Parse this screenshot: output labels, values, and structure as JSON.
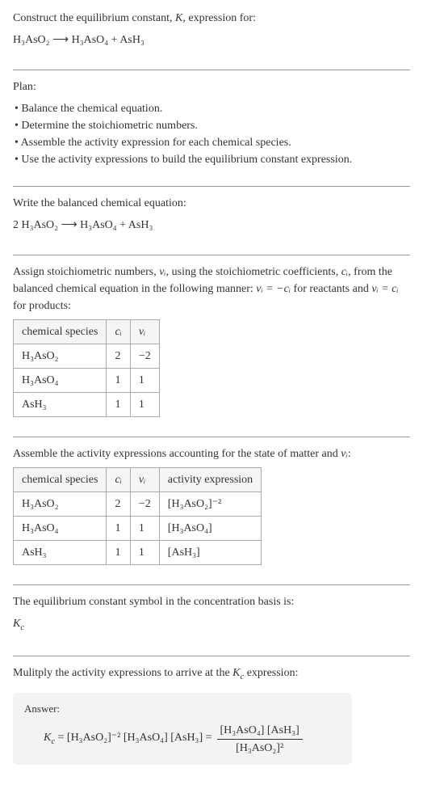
{
  "section1": {
    "line1_a": "Construct the equilibrium constant, ",
    "line1_b": ", expression for:",
    "equation": "H₃AsO₂  ⟶  H₃AsO₄ + AsH₃"
  },
  "section2": {
    "heading": "Plan:",
    "b1": "• Balance the chemical equation.",
    "b2": "• Determine the stoichiometric numbers.",
    "b3": "• Assemble the activity expression for each chemical species.",
    "b4": "• Use the activity expressions to build the equilibrium constant expression."
  },
  "section3": {
    "heading": "Write the balanced chemical equation:",
    "equation": "2 H₃AsO₂  ⟶  H₃AsO₄ + AsH₃"
  },
  "section4": {
    "intro_a": "Assign stoichiometric numbers, ",
    "intro_b": ", using the stoichiometric coefficients, ",
    "intro_c": ", from the balanced chemical equation in the following manner: ",
    "intro_d": " for reactants and ",
    "intro_e": " for products:",
    "nu": "νᵢ",
    "ci": "cᵢ",
    "rel1": "νᵢ = −cᵢ",
    "rel2": "νᵢ = cᵢ",
    "table": {
      "h1": "chemical species",
      "h2": "cᵢ",
      "h3": "νᵢ",
      "r1c1": "H₃AsO₂",
      "r1c2": "2",
      "r1c3": "−2",
      "r2c1": "H₃AsO₄",
      "r2c2": "1",
      "r2c3": "1",
      "r3c1": "AsH₃",
      "r3c2": "1",
      "r3c3": "1"
    }
  },
  "section5": {
    "heading_a": "Assemble the activity expressions accounting for the state of matter and ",
    "heading_b": ":",
    "nu": "νᵢ",
    "table": {
      "h1": "chemical species",
      "h2": "cᵢ",
      "h3": "νᵢ",
      "h4": "activity expression",
      "r1c1": "H₃AsO₂",
      "r1c2": "2",
      "r1c3": "−2",
      "r1c4": "[H₃AsO₂]⁻²",
      "r2c1": "H₃AsO₄",
      "r2c2": "1",
      "r2c3": "1",
      "r2c4": "[H₃AsO₄]",
      "r3c1": "AsH₃",
      "r3c2": "1",
      "r3c3": "1",
      "r3c4": "[AsH₃]"
    }
  },
  "section6": {
    "heading": "The equilibrium constant symbol in the concentration basis is:",
    "symbol": "K",
    "sub": "c"
  },
  "section7": {
    "heading_a": "Mulitply the activity expressions to arrive at the ",
    "heading_b": " expression:",
    "kc": "K",
    "kcsub": "c"
  },
  "answer": {
    "label": "Answer:",
    "lhs_k": "K",
    "lhs_sub": "c",
    "lhs_eq": " = [H₃AsO₂]⁻² [H₃AsO₄] [AsH₃] = ",
    "num": "[H₃AsO₄] [AsH₃]",
    "den": "[H₃AsO₂]²"
  }
}
